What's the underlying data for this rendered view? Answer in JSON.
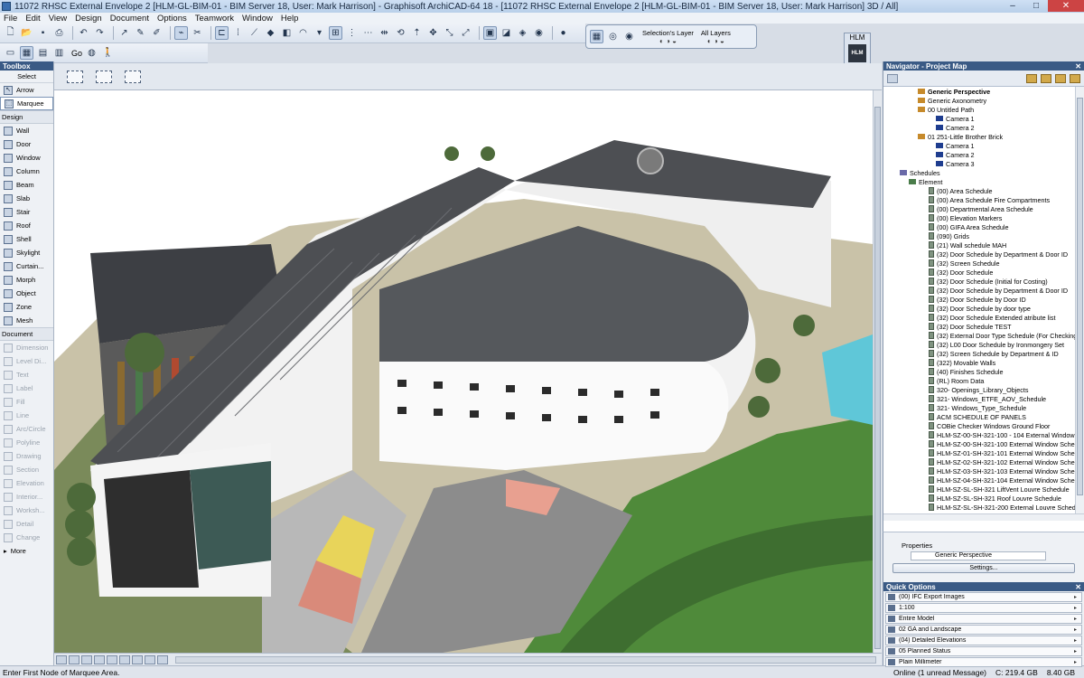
{
  "window": {
    "title": "11072 RHSC External Envelope 2 [HLM-GL-BIM-01 - BIM Server 18, User: Mark Harrison] - Graphisoft ArchiCAD-64 18 - [11072 RHSC External Envelope 2 [HLM-GL-BIM-01 - BIM Server 18, User: Mark Harrison] 3D / All]",
    "minimize": "–",
    "maximize": "□",
    "close": "✕"
  },
  "menu": [
    "File",
    "Edit",
    "View",
    "Design",
    "Document",
    "Options",
    "Teamwork",
    "Window",
    "Help"
  ],
  "toolbar": {
    "go_label": "Go"
  },
  "layer_palette": {
    "selections_layer": "Selection's Layer",
    "all_layers": "All Layers"
  },
  "hlm_badge": {
    "title": "HLM",
    "logo": "HLM"
  },
  "toolbox": {
    "title": "Toolbox",
    "select": "Select",
    "select_tools": [
      "Arrow",
      "Marquee"
    ],
    "design_section": "Design",
    "design_tools": [
      "Wall",
      "Door",
      "Window",
      "Column",
      "Beam",
      "Slab",
      "Stair",
      "Roof",
      "Shell",
      "Skylight",
      "Curtain...",
      "Morph",
      "Object",
      "Zone",
      "Mesh"
    ],
    "document_section": "Document",
    "document_tools": [
      "Dimension",
      "Level Di...",
      "Text",
      "Label",
      "Fill",
      "Line",
      "Arc/Circle",
      "Polyline",
      "Drawing",
      "Section",
      "Elevation",
      "Interior...",
      "Worksh...",
      "Detail",
      "Change"
    ],
    "more": "More"
  },
  "navigator": {
    "title": "Navigator - Project Map",
    "items": [
      {
        "label": "Generic Perspective",
        "icon": "folder",
        "bold": true
      },
      {
        "label": "Generic Axonometry",
        "icon": "folder",
        "bold": false
      },
      {
        "label": "00 Untitled Path",
        "icon": "folder",
        "bold": false
      },
      {
        "label": "Camera 1",
        "icon": "cam",
        "bold": false
      },
      {
        "label": "Camera 2",
        "icon": "cam",
        "bold": false
      },
      {
        "label": "01 251-Little Brother Brick",
        "icon": "folder",
        "bold": false
      },
      {
        "label": "Camera 1",
        "icon": "cam",
        "bold": false
      },
      {
        "label": "Camera 2",
        "icon": "cam",
        "bold": false
      },
      {
        "label": "Camera 3",
        "icon": "cam",
        "bold": false
      },
      {
        "label": "Schedules",
        "icon": "schedroot",
        "bold": false
      },
      {
        "label": "Element",
        "icon": "elem",
        "bold": false
      },
      {
        "label": "(00) Area Schedule",
        "icon": "sched",
        "bold": false
      },
      {
        "label": "(00) Area Schedule Fire Compartments",
        "icon": "sched",
        "bold": false
      },
      {
        "label": "(00) Departmental Area Schedule",
        "icon": "sched",
        "bold": false
      },
      {
        "label": "(00) Elevation Markers",
        "icon": "sched",
        "bold": false
      },
      {
        "label": "(00) GIFA Area Schedule",
        "icon": "sched",
        "bold": false
      },
      {
        "label": "(090) Grids",
        "icon": "sched",
        "bold": false
      },
      {
        "label": "(21) Wall schedule MAH",
        "icon": "sched",
        "bold": false
      },
      {
        "label": "(32) Door Schedule by Department & Door ID",
        "icon": "sched",
        "bold": false
      },
      {
        "label": "(32) Screen Schedule",
        "icon": "sched",
        "bold": false
      },
      {
        "label": "(32) Door Schedule",
        "icon": "sched",
        "bold": false
      },
      {
        "label": "(32) Door Schedule (Initial for Costing)",
        "icon": "sched",
        "bold": false
      },
      {
        "label": "(32) Door Schedule by Department & Door ID",
        "icon": "sched",
        "bold": false
      },
      {
        "label": "(32) Door Schedule by Door ID",
        "icon": "sched",
        "bold": false
      },
      {
        "label": "(32) Door Schedule by door type",
        "icon": "sched",
        "bold": false
      },
      {
        "label": "(32) Door Schedule Extended atribute list",
        "icon": "sched",
        "bold": false
      },
      {
        "label": "(32) Door Schedule TEST",
        "icon": "sched",
        "bold": false
      },
      {
        "label": "(32) External Door Type Schedule (For Checking)",
        "icon": "sched",
        "bold": false
      },
      {
        "label": "(32) L00 Door Schedule by Ironmongery Set",
        "icon": "sched",
        "bold": false
      },
      {
        "label": "(32) Screen Schedule by Department & ID",
        "icon": "sched",
        "bold": false
      },
      {
        "label": "(322)  Movable Walls",
        "icon": "sched",
        "bold": false
      },
      {
        "label": "(40) Finishes Schedule",
        "icon": "sched",
        "bold": false
      },
      {
        "label": "(RL) Room Data",
        "icon": "sched",
        "bold": false
      },
      {
        "label": "320- Openings_Library_Objects",
        "icon": "sched",
        "bold": false
      },
      {
        "label": "321- Windows_ETFE_AOV_Schedule",
        "icon": "sched",
        "bold": false
      },
      {
        "label": "321- Windows_Type_Schedule",
        "icon": "sched",
        "bold": false
      },
      {
        "label": "ACM SCHEDULE OF PANELS",
        "icon": "sched",
        "bold": false
      },
      {
        "label": "COBie Checker Windows Ground Floor",
        "icon": "sched",
        "bold": false
      },
      {
        "label": "HLM-SZ-00-SH-321-100 - 104 External Window S",
        "icon": "sched",
        "bold": false
      },
      {
        "label": "HLM-SZ-00-SH-321-100 External Window Schedu",
        "icon": "sched",
        "bold": false
      },
      {
        "label": "HLM-SZ-01-SH-321-101 External Window Schedu",
        "icon": "sched",
        "bold": false
      },
      {
        "label": "HLM-SZ-02-SH-321-102 External Window Schedu",
        "icon": "sched",
        "bold": false
      },
      {
        "label": "HLM-SZ-03-SH-321-103 External Window Schedu",
        "icon": "sched",
        "bold": false
      },
      {
        "label": "HLM-SZ-04-SH-321-104 External Window Schedu",
        "icon": "sched",
        "bold": false
      },
      {
        "label": "HLM-SZ-SL-SH-321 LiftVent Louvre Schedule",
        "icon": "sched",
        "bold": false
      },
      {
        "label": "HLM-SZ-SL-SH-321 Roof Louvre Schedule",
        "icon": "sched",
        "bold": false
      },
      {
        "label": "HLM-SZ-SL-SH-321-200 External Louvre Schedule",
        "icon": "sched",
        "bold": false
      }
    ]
  },
  "properties": {
    "title": "Properties",
    "name": "Generic Perspective",
    "settings_button": "Settings..."
  },
  "quick_options": {
    "title": "Quick Options",
    "rows": [
      "(00) IFC Export Images",
      "1:100",
      "Entire Model",
      "02 GA and Landscape",
      "(04) Detailed Elevations",
      "05 Planned Status",
      "Plain Millimeter"
    ]
  },
  "status": {
    "message": "Enter First Node of Marquee Area.",
    "online": "Online (1 unread Message)",
    "disk": "C: 219.4 GB",
    "memory": "8.40 GB"
  },
  "colors": {
    "panel_header": "#3a5a85",
    "pool": "#5fc7d8",
    "grass": "#4f8a3a",
    "roof": "#5c5f64"
  }
}
